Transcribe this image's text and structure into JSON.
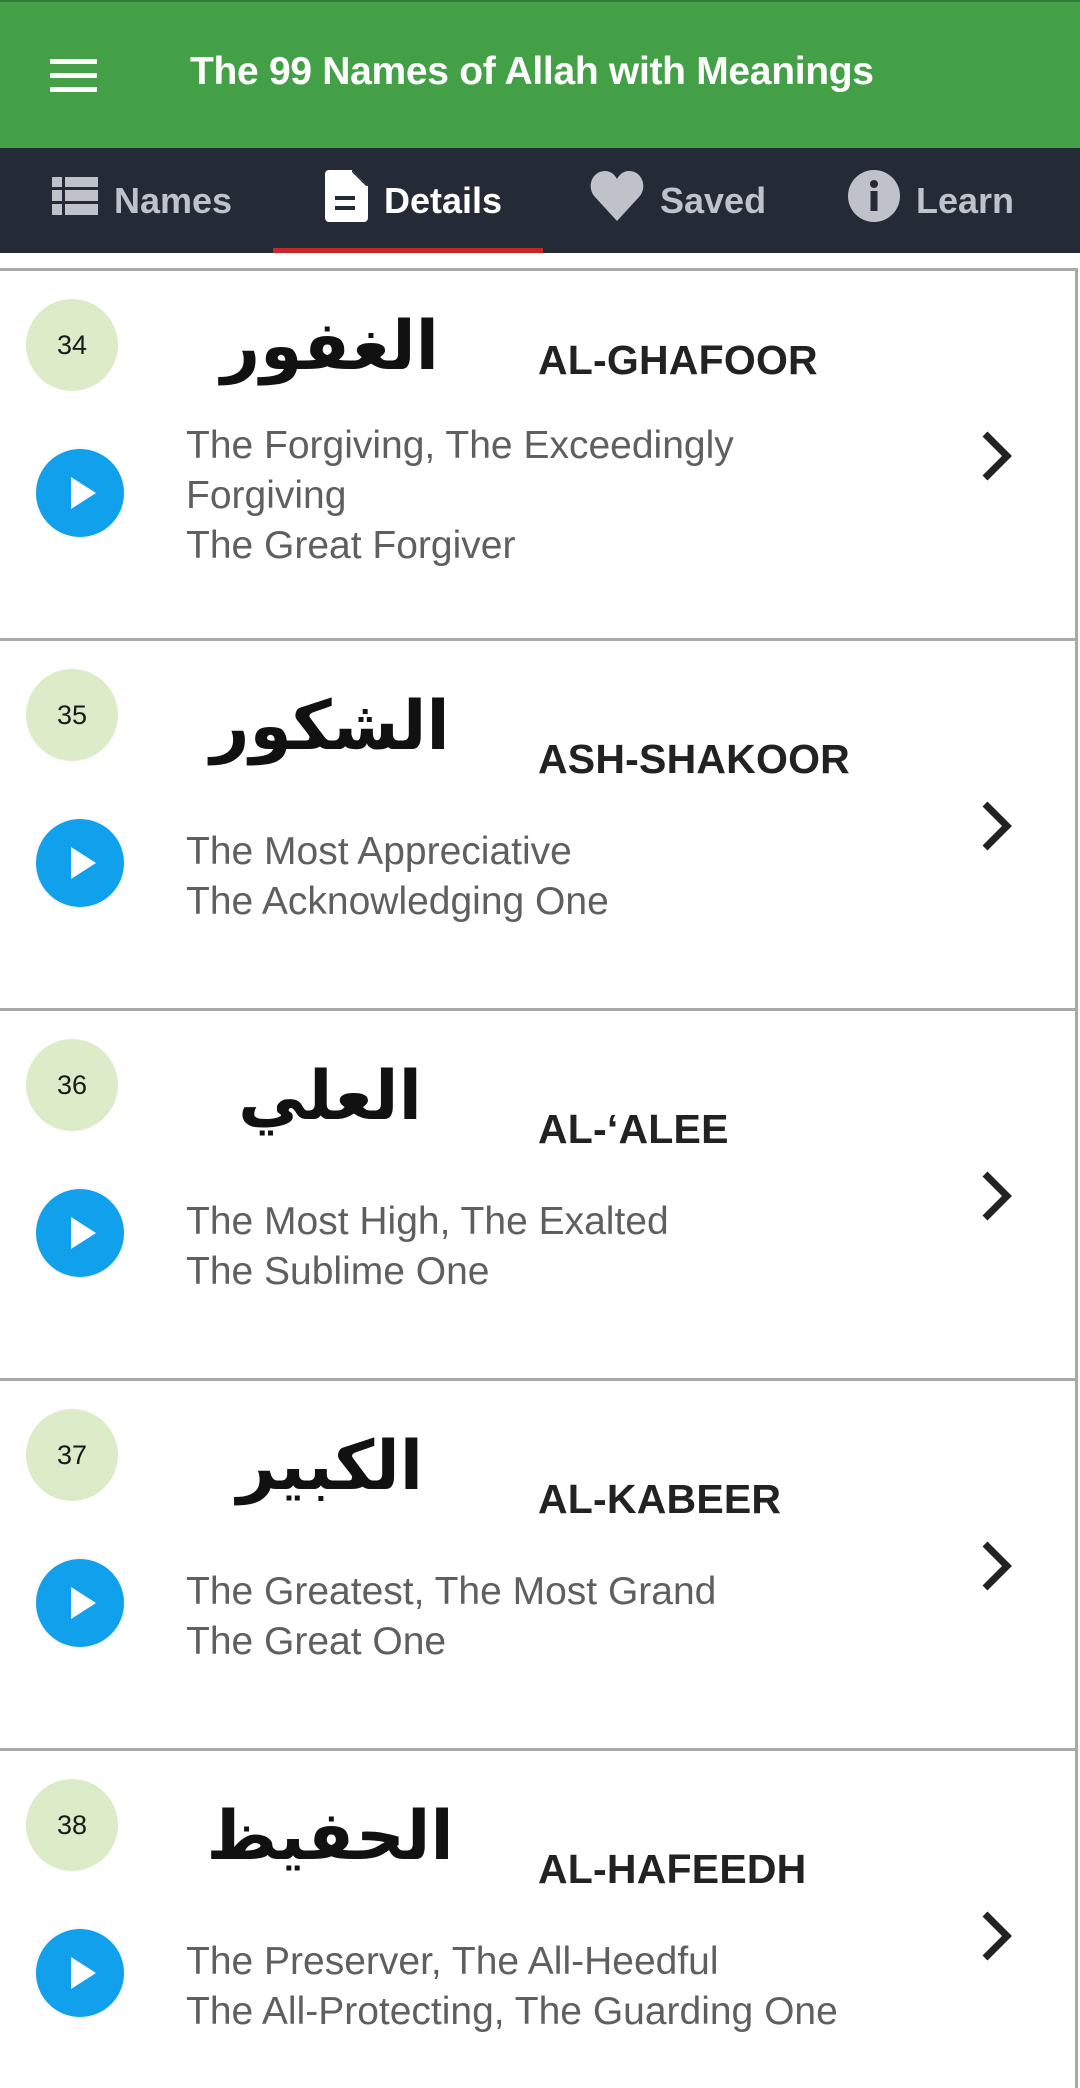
{
  "appbar": {
    "title": "The 99 Names of Allah with Meanings",
    "menu_icon": "hamburger-menu-icon",
    "color": "#43a047"
  },
  "tabs": [
    {
      "label": "Names",
      "icon": "list-icon",
      "active": false
    },
    {
      "label": "Details",
      "icon": "document-icon",
      "active": true
    },
    {
      "label": "Saved",
      "icon": "heart-icon",
      "active": false
    },
    {
      "label": "Learn",
      "icon": "info-icon",
      "active": false
    }
  ],
  "colors": {
    "tabbar_bg": "#252a37",
    "active_indicator": "#c62828",
    "badge_bg": "#dcebc8",
    "play_button": "#10a0ec"
  },
  "names": [
    {
      "number": "34",
      "arabic": "الغفور",
      "transliteration": "AL-GHAFOOR",
      "meaning_lines": [
        "The Forgiving, The Exceedingly",
        "Forgiving",
        "The Great Forgiver"
      ]
    },
    {
      "number": "35",
      "arabic": "الشكور",
      "transliteration": "ASH-SHAKOOR",
      "meaning_lines": [
        "The Most Appreciative",
        "The Acknowledging One"
      ]
    },
    {
      "number": "36",
      "arabic": "العلي",
      "transliteration": "AL-‘ALEE",
      "meaning_lines": [
        "The Most High, The Exalted",
        "The Sublime One"
      ]
    },
    {
      "number": "37",
      "arabic": "الكبير",
      "transliteration": "AL-KABEER",
      "meaning_lines": [
        "The Greatest, The Most Grand",
        "The Great One"
      ]
    },
    {
      "number": "38",
      "arabic": "الحفيظ",
      "transliteration": "AL-HAFEEDH",
      "meaning_lines": [
        "The Preserver, The All-Heedful",
        "The All-Protecting, The Guarding One"
      ]
    }
  ]
}
